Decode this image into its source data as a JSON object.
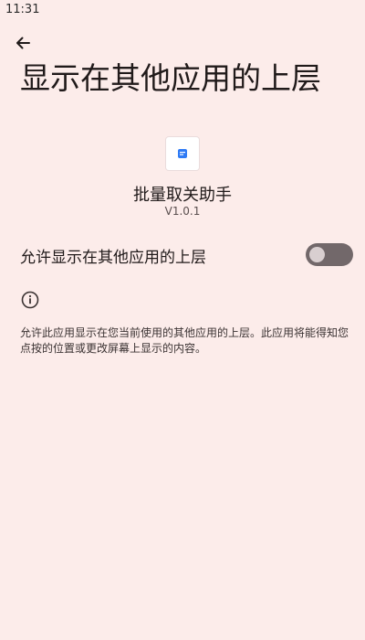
{
  "status_bar": {
    "time": "11:31"
  },
  "header": {
    "back_icon": "arrow-back-icon",
    "title": "显示在其他应用的上层"
  },
  "app": {
    "icon": "app-icon",
    "name": "批量取关助手",
    "version": "V1.0.1"
  },
  "setting": {
    "label": "允许显示在其他应用的上层",
    "enabled": false
  },
  "info": {
    "icon": "info-icon",
    "text": "允许此应用显示在您当前使用的其他应用的上层。此应用将能得知您点按的位置或更改屏幕上显示的内容。"
  },
  "colors": {
    "background": "#fcecea",
    "switch_track": "#72686a",
    "switch_knob": "#d9cfd0"
  }
}
